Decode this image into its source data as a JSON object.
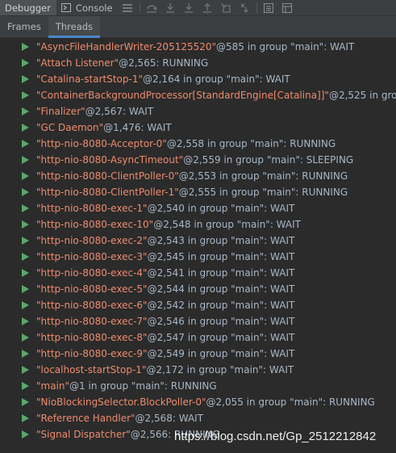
{
  "toolbar": {
    "debugger_tab": "Debugger",
    "console_tab": "Console",
    "icons": [
      "hamburger-icon",
      "step-over-icon",
      "step-into-icon",
      "force-step-into-icon",
      "step-out-icon",
      "drop-frame-icon",
      "run-to-cursor-icon",
      "evaluate-icon",
      "restore-layout-icon"
    ]
  },
  "subtabs": {
    "frames": "Frames",
    "threads": "Threads"
  },
  "threads": [
    {
      "name": "\"AsyncFileHandlerWriter-205125520\"",
      "info": "@585 in group \"main\": WAIT"
    },
    {
      "name": "\"Attach Listener\"",
      "info": "@2,565: RUNNING"
    },
    {
      "name": "\"Catalina-startStop-1\"",
      "info": "@2,164 in group \"main\": WAIT"
    },
    {
      "name": "\"ContainerBackgroundProcessor[StandardEngine[Catalina]]\"",
      "info": "@2,525 in group"
    },
    {
      "name": "\"Finalizer\"",
      "info": "@2,567: WAIT"
    },
    {
      "name": "\"GC Daemon\"",
      "info": "@1,476: WAIT"
    },
    {
      "name": "\"http-nio-8080-Acceptor-0\"",
      "info": "@2,558 in group \"main\": RUNNING"
    },
    {
      "name": "\"http-nio-8080-AsyncTimeout\"",
      "info": "@2,559 in group \"main\": SLEEPING"
    },
    {
      "name": "\"http-nio-8080-ClientPoller-0\"",
      "info": "@2,553 in group \"main\": RUNNING"
    },
    {
      "name": "\"http-nio-8080-ClientPoller-1\"",
      "info": "@2,555 in group \"main\": RUNNING"
    },
    {
      "name": "\"http-nio-8080-exec-1\"",
      "info": "@2,540 in group \"main\": WAIT"
    },
    {
      "name": "\"http-nio-8080-exec-10\"",
      "info": "@2,548 in group \"main\": WAIT"
    },
    {
      "name": "\"http-nio-8080-exec-2\"",
      "info": "@2,543 in group \"main\": WAIT"
    },
    {
      "name": "\"http-nio-8080-exec-3\"",
      "info": "@2,545 in group \"main\": WAIT"
    },
    {
      "name": "\"http-nio-8080-exec-4\"",
      "info": "@2,541 in group \"main\": WAIT"
    },
    {
      "name": "\"http-nio-8080-exec-5\"",
      "info": "@2,544 in group \"main\": WAIT"
    },
    {
      "name": "\"http-nio-8080-exec-6\"",
      "info": "@2,542 in group \"main\": WAIT"
    },
    {
      "name": "\"http-nio-8080-exec-7\"",
      "info": "@2,546 in group \"main\": WAIT"
    },
    {
      "name": "\"http-nio-8080-exec-8\"",
      "info": "@2,547 in group \"main\": WAIT"
    },
    {
      "name": "\"http-nio-8080-exec-9\"",
      "info": "@2,549 in group \"main\": WAIT"
    },
    {
      "name": "\"localhost-startStop-1\"",
      "info": "@2,172 in group \"main\": WAIT"
    },
    {
      "name": "\"main\"",
      "info": "@1 in group \"main\": RUNNING"
    },
    {
      "name": "\"NioBlockingSelector.BlockPoller-0\"",
      "info": "@2,055 in group \"main\": RUNNING"
    },
    {
      "name": "\"Reference Handler\"",
      "info": "@2,568: WAIT"
    },
    {
      "name": "\"Signal Dispatcher\"",
      "info": "@2,566: RUNNING"
    }
  ],
  "watermark": "https://blog.csdn.net/Gp_2512212842",
  "colors": {
    "thread_name": "#ee8b6d",
    "thread_info": "#a9b7c6",
    "run_arrow": "#59a869",
    "active_tab_underline": "#4a88c7"
  }
}
